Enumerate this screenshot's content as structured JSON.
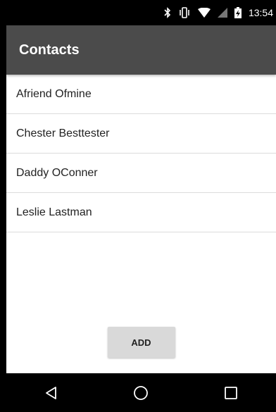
{
  "status_bar": {
    "time": "13:54",
    "icons": [
      "bluetooth-icon",
      "vibrate-icon",
      "wifi-icon",
      "signal-icon",
      "battery-icon"
    ]
  },
  "app_bar": {
    "title": "Contacts",
    "color": "#4b4b4b"
  },
  "contacts": [
    {
      "name": "Afriend Ofmine"
    },
    {
      "name": "Chester Besttester"
    },
    {
      "name": "Daddy OConner"
    },
    {
      "name": "Leslie Lastman"
    }
  ],
  "add_button": {
    "label": "ADD"
  },
  "nav_bar": {
    "icons": [
      "back-icon",
      "home-icon",
      "recents-icon"
    ]
  }
}
